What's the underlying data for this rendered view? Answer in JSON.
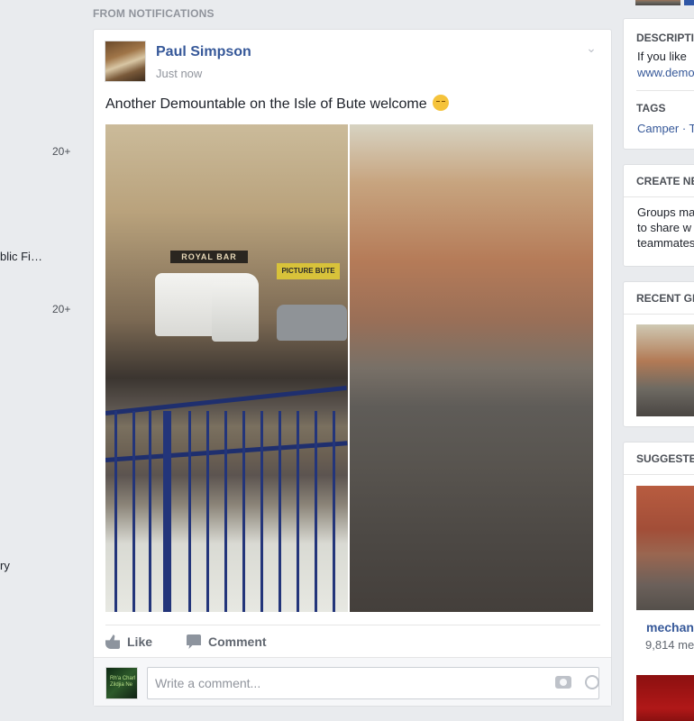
{
  "left_sidebar": {
    "fragments": [
      {
        "text": "20+"
      },
      {
        "text": "blic Fi…"
      },
      {
        "text": "20+"
      },
      {
        "text": "ry"
      }
    ]
  },
  "feed": {
    "section_label": "FROM NOTIFICATIONS",
    "post": {
      "author": "Paul Simpson",
      "timestamp": "Just now",
      "text": "Another Demountable on the Isle of Bute welcome",
      "photo_signs": {
        "left_sign": "ROYAL BAR",
        "right_sign": "PICTURE BUTE"
      },
      "actions": {
        "like": "Like",
        "comment": "Comment"
      },
      "comment_box": {
        "placeholder": "Write a comment...",
        "avatar_text": "Rh'a Charl Zildjia Ne"
      }
    }
  },
  "right_column": {
    "description": {
      "header": "DESCRIPTI",
      "text": "If you like",
      "link": "www.demo"
    },
    "tags": {
      "header": "TAGS",
      "value": "Camper · T"
    },
    "create_new": {
      "header": "CREATE NE",
      "lines": [
        "Groups ma",
        "to share w",
        "teammates"
      ]
    },
    "recent": {
      "header": "RECENT GI"
    },
    "suggested": {
      "header": "SUGGESTE",
      "group_name": "mechani",
      "members": "9,814 me"
    }
  },
  "colors": {
    "link": "#365899",
    "background": "#e9ebee",
    "fence_blue": "#23357a"
  }
}
